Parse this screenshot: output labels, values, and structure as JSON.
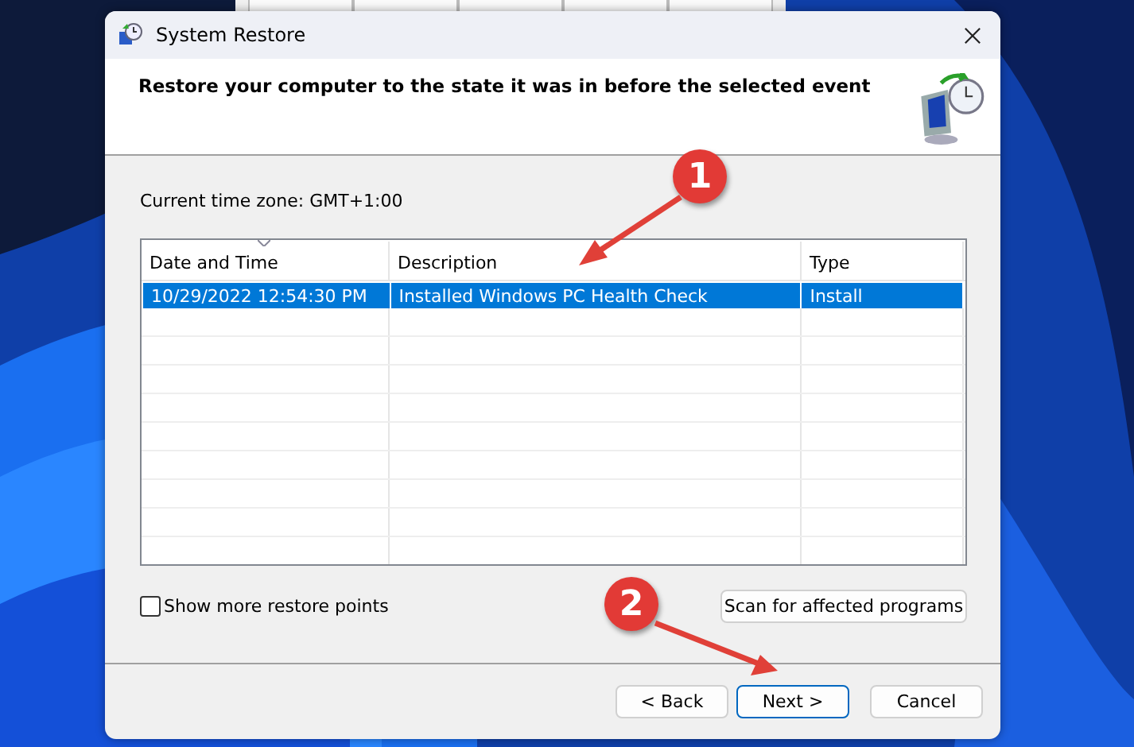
{
  "window": {
    "title": "System Restore"
  },
  "header": {
    "heading": "Restore your computer to the state it was in before the selected event"
  },
  "timezone": "Current time zone: GMT+1:00",
  "table": {
    "columns": [
      "Date and Time",
      "Description",
      "Type"
    ],
    "rows": [
      {
        "cells": [
          "10/29/2022 12:54:30 PM",
          "Installed Windows PC Health Check",
          "Install"
        ],
        "selected": true
      }
    ]
  },
  "show_more": {
    "label": "Show more restore points",
    "checked": false
  },
  "scan_button": "Scan for affected programs",
  "buttons": [
    {
      "label": "< Back",
      "selected": false
    },
    {
      "label": "Next >",
      "selected": true
    },
    {
      "label": "Cancel",
      "selected": false
    }
  ],
  "annotations": [
    "1",
    "2"
  ]
}
